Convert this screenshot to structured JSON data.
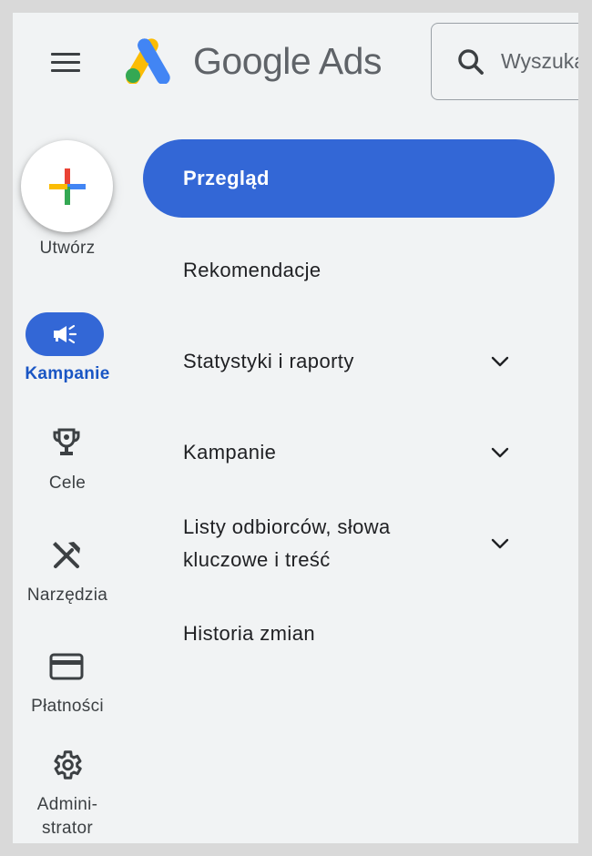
{
  "header": {
    "brand": "Google Ads",
    "search_placeholder": "Wyszukaj",
    "icons": [
      "menu-icon",
      "google-ads-logo",
      "search-icon"
    ]
  },
  "rail": {
    "create_label": "Utwórz",
    "items": [
      {
        "label": "Kampanie",
        "icon": "megaphone-icon",
        "active": true
      },
      {
        "label": "Cele",
        "icon": "trophy-icon",
        "active": false
      },
      {
        "label": "Narzędzia",
        "icon": "tools-icon",
        "active": false
      },
      {
        "label": "Płatności",
        "icon": "credit-card-icon",
        "active": false
      },
      {
        "label_line1": "Admini-",
        "label_line2": "strator",
        "icon": "gear-icon",
        "active": false
      }
    ]
  },
  "nav": {
    "items": [
      {
        "label": "Przegląd",
        "selected": true,
        "expandable": false
      },
      {
        "label": "Rekomendacje",
        "selected": false,
        "expandable": false
      },
      {
        "label": "Statystyki i raporty",
        "selected": false,
        "expandable": true
      },
      {
        "label": "Kampanie",
        "selected": false,
        "expandable": true
      },
      {
        "label_line1": "Listy odbiorców, słowa",
        "label_line2": "kluczowe i treść",
        "selected": false,
        "expandable": true
      },
      {
        "label": "Historia zmian",
        "selected": false,
        "expandable": false
      }
    ]
  },
  "colors": {
    "accent": "#3367d6",
    "accent_text": "#1a56c4",
    "background": "#f1f3f4",
    "logo_blue": "#4285f4",
    "logo_yellow": "#fbbc04",
    "logo_green": "#34a853",
    "logo_red": "#ea4335"
  }
}
